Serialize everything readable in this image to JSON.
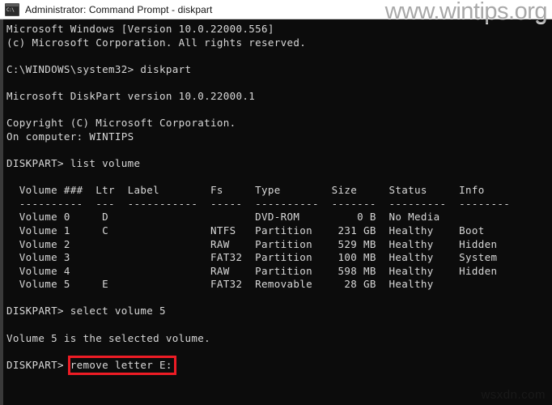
{
  "window": {
    "title": "Administrator: Command Prompt - diskpart",
    "icon": "console-window-icon",
    "titlebar_bg": "#ffffff",
    "titlebar_fg": "#111111",
    "console_bg": "#0c0c0c",
    "console_fg": "#d8d8d8"
  },
  "watermarks": {
    "primary": "www.wintips.org",
    "secondary": "wsxdn.com"
  },
  "highlight": {
    "color": "#ee1c25",
    "target_text": "remove letter E:"
  },
  "console": {
    "lines": [
      "Microsoft Windows [Version 10.0.22000.556]",
      "(c) Microsoft Corporation. All rights reserved.",
      "",
      "C:\\WINDOWS\\system32> diskpart",
      "",
      "Microsoft DiskPart version 10.0.22000.1",
      "",
      "Copyright (C) Microsoft Corporation.",
      "On computer: WINTIPS",
      "",
      "DISKPART> list volume",
      "",
      "  Volume ###  Ltr  Label        Fs     Type        Size     Status     Info",
      "  ----------  ---  -----------  -----  ----------  -------  ---------  --------",
      "  Volume 0     D                       DVD-ROM         0 B  No Media",
      "  Volume 1     C                NTFS   Partition    231 GB  Healthy    Boot",
      "  Volume 2                      RAW    Partition    529 MB  Healthy    Hidden",
      "  Volume 3                      FAT32  Partition    100 MB  Healthy    System",
      "  Volume 4                      RAW    Partition    598 MB  Healthy    Hidden",
      "  Volume 5     E                FAT32  Removable     28 GB  Healthy",
      "",
      "DISKPART> select volume 5",
      "",
      "Volume 5 is the selected volume.",
      "",
      "DISKPART> remove letter E:"
    ],
    "prompt": "DISKPART>",
    "shell_prompt": "C:\\WINDOWS\\system32>",
    "commands": [
      "diskpart",
      "list volume",
      "select volume 5",
      "remove letter E:"
    ],
    "volume_table": {
      "headers": [
        "Volume ###",
        "Ltr",
        "Label",
        "Fs",
        "Type",
        "Size",
        "Status",
        "Info"
      ],
      "rows": [
        {
          "volume": "Volume 0",
          "ltr": "D",
          "label": "",
          "fs": "",
          "type": "DVD-ROM",
          "size": "0 B",
          "status": "No Media",
          "info": ""
        },
        {
          "volume": "Volume 1",
          "ltr": "C",
          "label": "",
          "fs": "NTFS",
          "type": "Partition",
          "size": "231 GB",
          "status": "Healthy",
          "info": "Boot"
        },
        {
          "volume": "Volume 2",
          "ltr": "",
          "label": "",
          "fs": "RAW",
          "type": "Partition",
          "size": "529 MB",
          "status": "Healthy",
          "info": "Hidden"
        },
        {
          "volume": "Volume 3",
          "ltr": "",
          "label": "",
          "fs": "FAT32",
          "type": "Partition",
          "size": "100 MB",
          "status": "Healthy",
          "info": "System"
        },
        {
          "volume": "Volume 4",
          "ltr": "",
          "label": "",
          "fs": "RAW",
          "type": "Partition",
          "size": "598 MB",
          "status": "Healthy",
          "info": "Hidden"
        },
        {
          "volume": "Volume 5",
          "ltr": "E",
          "label": "",
          "fs": "FAT32",
          "type": "Removable",
          "size": "28 GB",
          "status": "Healthy",
          "info": ""
        }
      ]
    },
    "messages": [
      "Microsoft Windows [Version 10.0.22000.556]",
      "(c) Microsoft Corporation. All rights reserved.",
      "Microsoft DiskPart version 10.0.22000.1",
      "Copyright (C) Microsoft Corporation.",
      "On computer: WINTIPS",
      "Volume 5 is the selected volume."
    ]
  }
}
